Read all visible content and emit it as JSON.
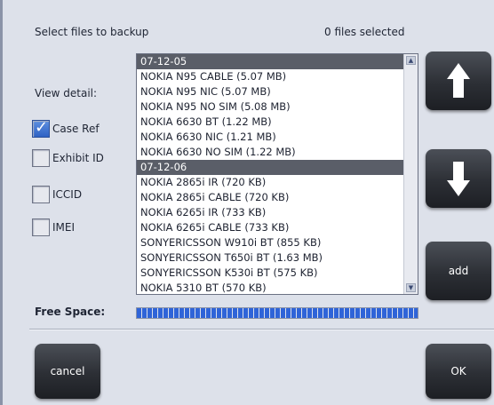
{
  "header": {
    "title": "Select files to backup",
    "selection_status": "0 files selected"
  },
  "view_detail": {
    "label": "View detail:",
    "options": [
      {
        "label": "Case Ref",
        "checked": true
      },
      {
        "label": "Exhibit ID",
        "checked": false
      },
      {
        "label": "ICCID",
        "checked": false
      },
      {
        "label": "IMEI",
        "checked": false
      }
    ]
  },
  "file_list": {
    "rows": [
      {
        "text": "07-12-05",
        "group": true
      },
      {
        "text": "NOKIA N95 CABLE (5.07 MB)",
        "group": false
      },
      {
        "text": "NOKIA N95 NIC (5.07 MB)",
        "group": false
      },
      {
        "text": "NOKIA N95 NO SIM (5.08 MB)",
        "group": false
      },
      {
        "text": "NOKIA 6630 BT (1.22 MB)",
        "group": false
      },
      {
        "text": "NOKIA 6630 NIC (1.21 MB)",
        "group": false
      },
      {
        "text": "NOKIA 6630 NO SIM (1.22 MB)",
        "group": false
      },
      {
        "text": "07-12-06",
        "group": true
      },
      {
        "text": "NOKIA 2865i IR (720 KB)",
        "group": false
      },
      {
        "text": "NOKIA 2865i CABLE (720 KB)",
        "group": false
      },
      {
        "text": "NOKIA 6265i IR (733 KB)",
        "group": false
      },
      {
        "text": "NOKIA 6265i CABLE (733 KB)",
        "group": false
      },
      {
        "text": "SONYERICSSON W910i BT (855 KB)",
        "group": false
      },
      {
        "text": "SONYERICSSON T650i BT (1.63 MB)",
        "group": false
      },
      {
        "text": "SONYERICSSON K530i BT (575 KB)",
        "group": false
      },
      {
        "text": "NOKIA 5310 BT (570 KB)",
        "group": false
      }
    ]
  },
  "free_space": {
    "label": "Free Space:",
    "fraction": 1.0
  },
  "buttons": {
    "add": "add",
    "cancel": "cancel",
    "ok": "OK",
    "move_up_icon": "arrow-up-icon",
    "move_down_icon": "arrow-down-icon"
  }
}
